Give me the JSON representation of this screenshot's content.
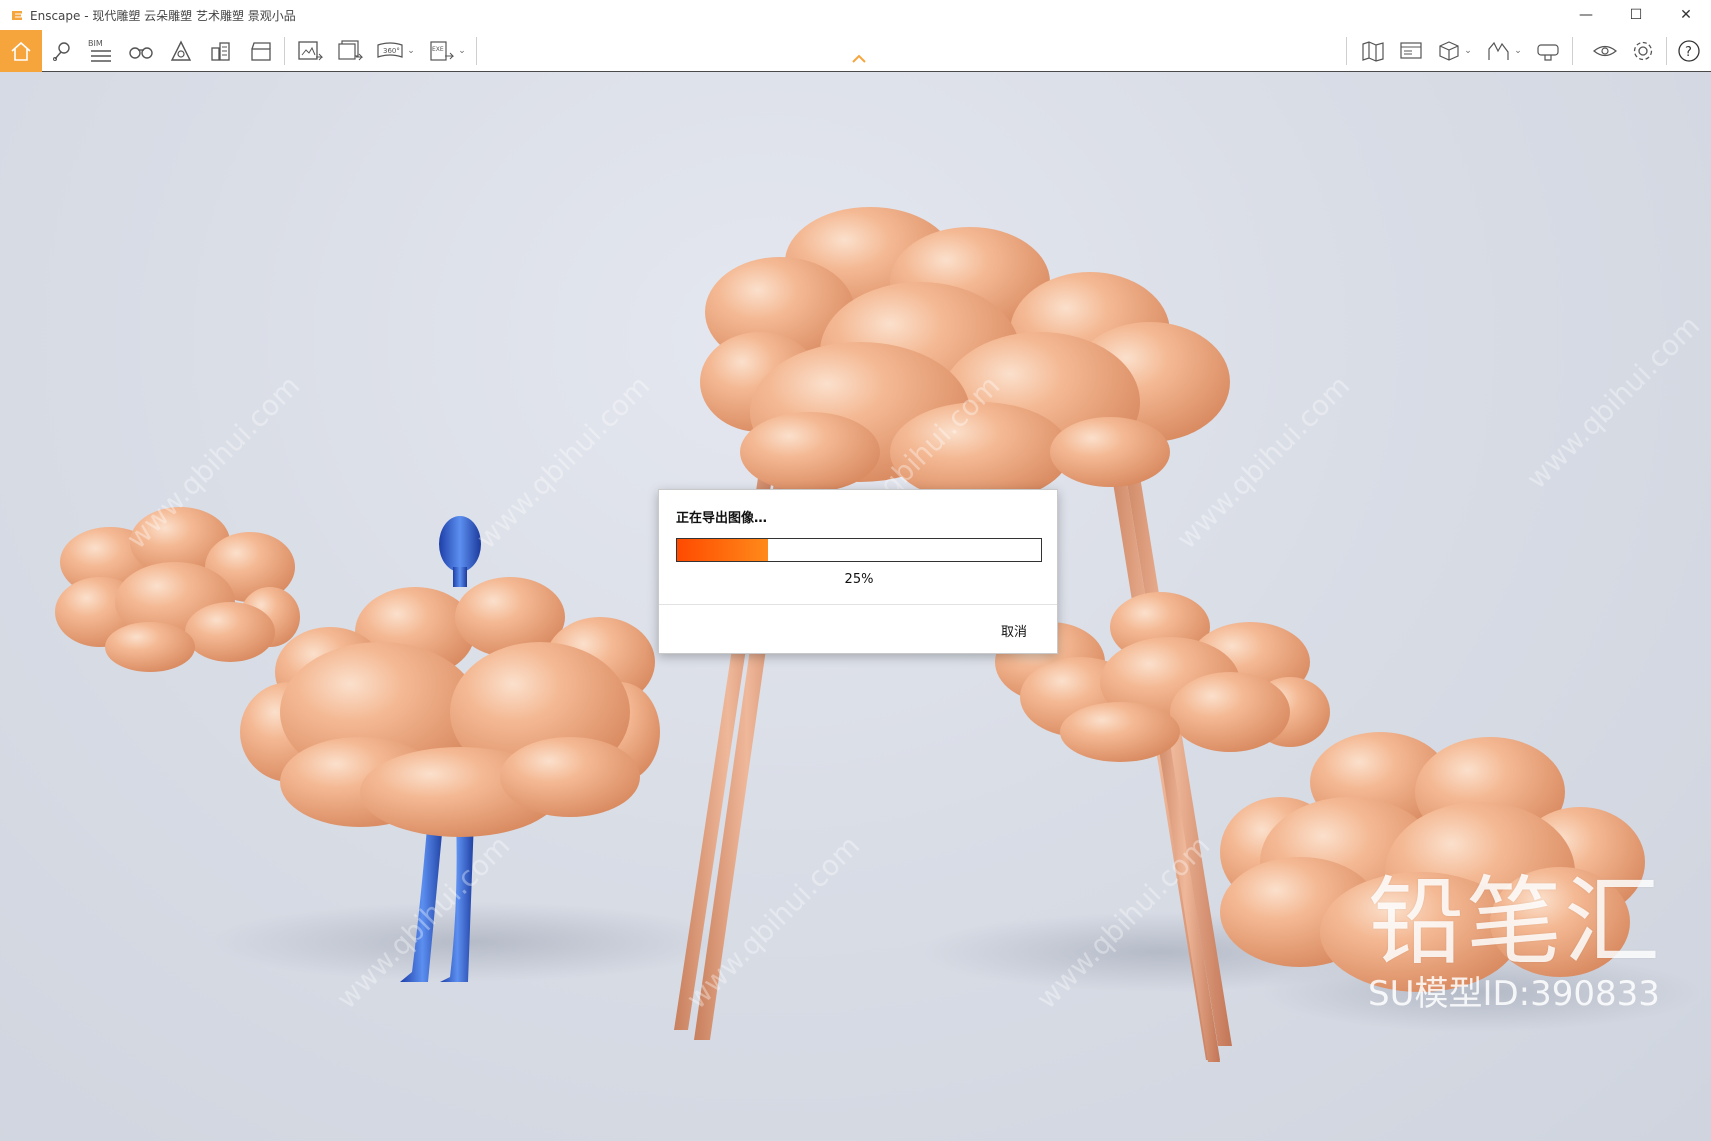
{
  "window": {
    "app_name": "Enscape",
    "title": "Enscape - 现代雕塑 云朵雕塑 艺术雕塑 景观小品",
    "controls": {
      "minimize": "—",
      "maximize": "☐",
      "close": "✕"
    }
  },
  "toolbar": {
    "bim_label": "BIM",
    "pano_label": "360°",
    "exe_label": "EXE",
    "accent_color": "#f6a53c"
  },
  "dialog": {
    "title": "正在导出图像…",
    "progress": 0.25,
    "progress_text": "25%",
    "cancel_label": "取消"
  },
  "watermark": {
    "brand": "铅笔汇",
    "model_id": "SU模型ID:390833",
    "tile_text": "www.qbihui.com"
  },
  "colors": {
    "progress_start": "#ff4a00",
    "progress_end": "#ff8a1a",
    "cloud": "#f2b48e",
    "figure": "#2c5fd0"
  }
}
